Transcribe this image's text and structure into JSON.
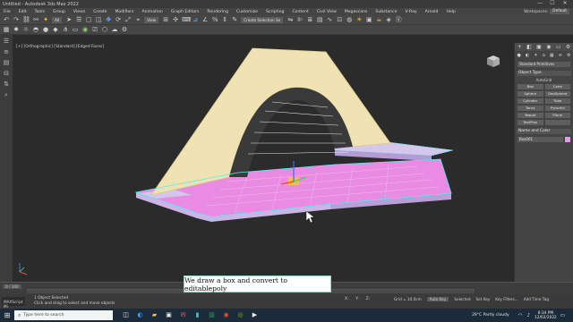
{
  "window": {
    "title": "Untitled - Autodesk 3ds Max 2022",
    "controls": [
      "—",
      "☐",
      "✕"
    ]
  },
  "menu": {
    "items": [
      "File",
      "Edit",
      "Tools",
      "Group",
      "Views",
      "Create",
      "Modifiers",
      "Animation",
      "Graph Editors",
      "Rendering",
      "Customize",
      "Scripting",
      "Content",
      "Civil View",
      "Megascans",
      "Substance",
      "V-Ray",
      "Arnold",
      "Help"
    ],
    "workspace_label": "Workspaces:",
    "workspace_value": "Default"
  },
  "toolbar": {
    "selection_filter": "All",
    "view_mode": "View",
    "selection_set": "Create Selection Se"
  },
  "viewport": {
    "label": "[+] [Orthographic] [Standard] [Edged Faces]"
  },
  "command_panel": {
    "tabs": [
      "+",
      "◧",
      "▣",
      "◉",
      "▭",
      "⚙"
    ],
    "subtabs": [
      "●",
      "◐",
      "✶",
      "⌂",
      "▦",
      "≋",
      "⚙"
    ],
    "category": "Standard Primitives",
    "object_type_title": "Object Type",
    "autogrid": "AutoGrid",
    "objects": [
      "Box",
      "Cone",
      "Sphere",
      "GeoSphere",
      "Cylinder",
      "Tube",
      "Torus",
      "Pyramid",
      "Teapot",
      "Plane",
      "TextPlus",
      ""
    ],
    "name_color_title": "Name and Color",
    "name_value": "Box001",
    "color": "#e39be3"
  },
  "timeline": {
    "frame": "0 / 100"
  },
  "status": {
    "script_label": "MAXScript Mi",
    "selected": "1 Object Selected",
    "prompt": "Click and drag to select and move objects",
    "coords": [
      "X:",
      "Y:",
      "Z:",
      "Grid = 10.0cm"
    ],
    "auto_key": "Auto Key",
    "selected_mode": "Selected",
    "set_key": "Set Key",
    "key_filters": "Key Filters...",
    "add_time_tag": "Add Time Tag"
  },
  "caption": {
    "text": "We draw a box and convert to editablepoly"
  },
  "taskbar": {
    "search_placeholder": "Type here to search",
    "weather": "29°C  Partly cloudy",
    "time": "8:34 PM",
    "date": "12/02/2022"
  },
  "colors": {
    "arch_fill": "#efe2b3",
    "arch_edge": "#d8c88f",
    "slab_fill": "#e98be3",
    "slab_edge": "#c56dc0",
    "side_fill": "#c9b6e6",
    "selection_cyan": "#5ee8f0"
  }
}
